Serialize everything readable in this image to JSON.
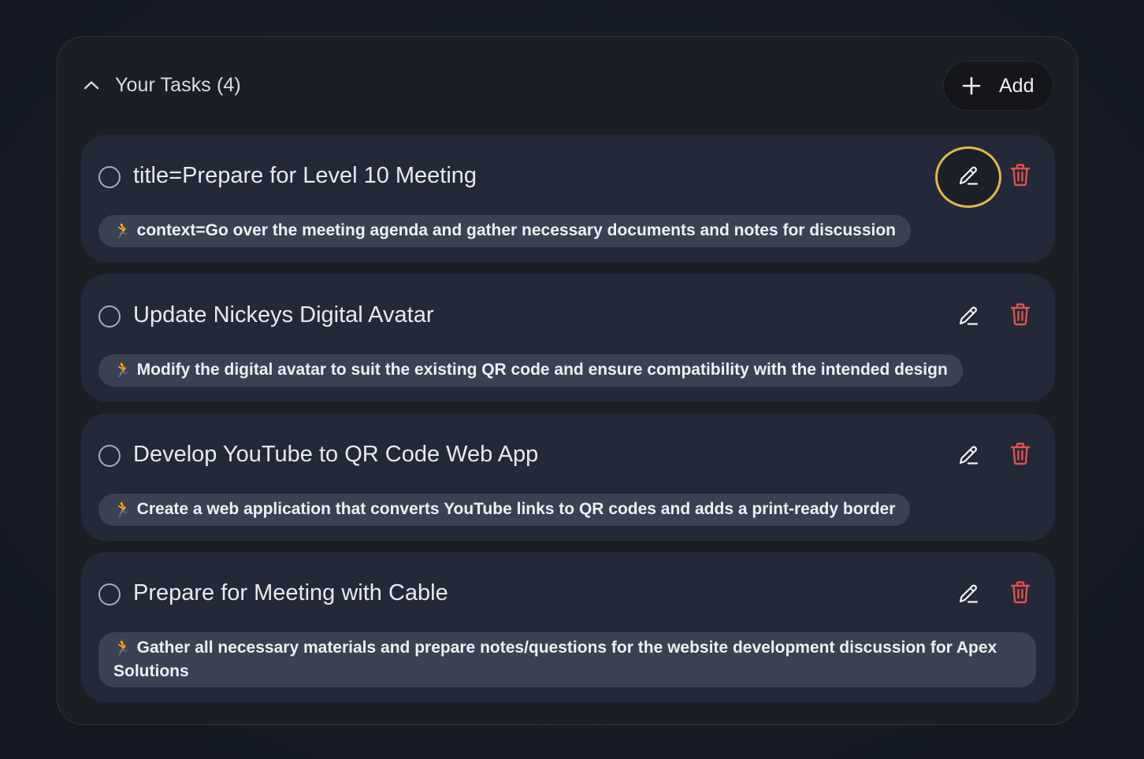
{
  "header": {
    "title": "Your Tasks (4)",
    "add_label": "Add"
  },
  "colors": {
    "accent_focus": "#e0b84a",
    "delete": "#e0524f",
    "card": "#232938",
    "pill": "#3a4152"
  },
  "tasks": [
    {
      "title": "title=Prepare for Level 10 Meeting",
      "context": "context=Go over the meeting agenda and gather necessary documents and notes for discussion",
      "context_icon": "runner-emoji",
      "focused_edit": true
    },
    {
      "title": "Update Nickeys Digital Avatar",
      "context": "Modify the digital avatar to suit the existing QR code and ensure compatibility with the intended design",
      "context_icon": "runner-emoji",
      "focused_edit": false
    },
    {
      "title": "Develop YouTube to QR Code Web App",
      "context": "Create a web application that converts YouTube links to QR codes and adds a print-ready border",
      "context_icon": "runner-emoji",
      "focused_edit": false
    },
    {
      "title": "Prepare for Meeting with Cable",
      "context": "Gather all necessary materials and prepare notes/questions for the website development discussion for Apex Solutions",
      "context_icon": "runner-emoji",
      "focused_edit": false
    }
  ]
}
